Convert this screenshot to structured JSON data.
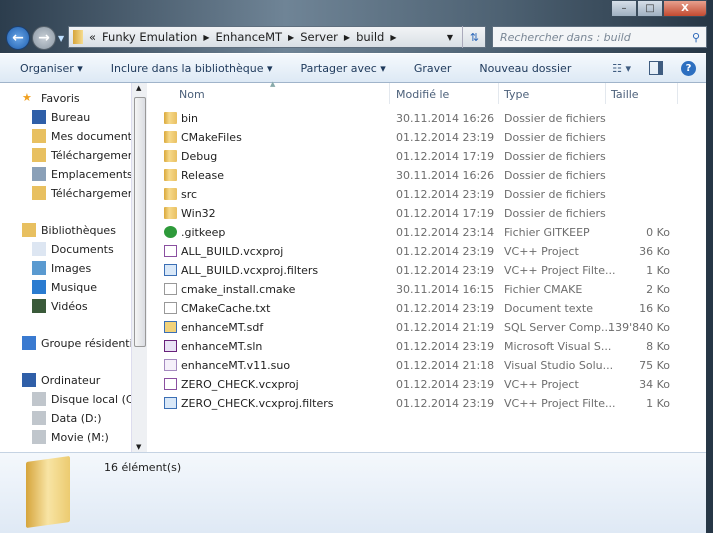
{
  "window": {
    "controls": {
      "minimize": "–",
      "maximize": "□",
      "close": "X"
    }
  },
  "address": {
    "prefix": "«",
    "crumbs": [
      "Funky Emulation",
      "EnhanceMT",
      "Server",
      "build"
    ],
    "search_placeholder": "Rechercher dans : build"
  },
  "toolbar": {
    "organize": "Organiser ▾",
    "include": "Inclure dans la bibliothèque ▾",
    "share": "Partager avec ▾",
    "burn": "Graver",
    "new_folder": "Nouveau dossier",
    "help": "?"
  },
  "sidebar": {
    "items": [
      {
        "label": "Favoris",
        "icon": "star-icon",
        "level": 0
      },
      {
        "label": "Bureau",
        "icon": "desktop-icon",
        "level": 1
      },
      {
        "label": "Mes documents",
        "icon": "documents-folder-icon",
        "level": 1
      },
      {
        "label": "Téléchargements",
        "icon": "downloads-icon",
        "level": 1
      },
      {
        "label": "Emplacements récents",
        "icon": "recent-places-icon",
        "level": 1
      },
      {
        "label": "Téléchargements",
        "icon": "downloads-icon",
        "level": 1
      },
      {
        "label": "Bibliothèques",
        "icon": "libraries-icon",
        "level": 0
      },
      {
        "label": "Documents",
        "icon": "document-icon",
        "level": 1
      },
      {
        "label": "Images",
        "icon": "pictures-icon",
        "level": 1
      },
      {
        "label": "Musique",
        "icon": "music-icon",
        "level": 1
      },
      {
        "label": "Vidéos",
        "icon": "video-icon",
        "level": 1
      },
      {
        "label": "Groupe résidentiel",
        "icon": "homegroup-icon",
        "level": 0
      },
      {
        "label": "Ordinateur",
        "icon": "computer-icon",
        "level": 0
      },
      {
        "label": "Disque local (C:)",
        "icon": "drive-icon",
        "level": 1
      },
      {
        "label": "Data (D:)",
        "icon": "drive-icon",
        "level": 1
      },
      {
        "label": "Movie (M:)",
        "icon": "drive-icon",
        "level": 1
      }
    ]
  },
  "columns": {
    "name": "Nom",
    "modified": "Modifié le",
    "type": "Type",
    "size": "Taille"
  },
  "files": [
    {
      "name": "bin",
      "modified": "30.11.2014 16:26",
      "type": "Dossier de fichiers",
      "size": "",
      "icon": "folder"
    },
    {
      "name": "CMakeFiles",
      "modified": "01.12.2014 23:19",
      "type": "Dossier de fichiers",
      "size": "",
      "icon": "folder"
    },
    {
      "name": "Debug",
      "modified": "01.12.2014 17:19",
      "type": "Dossier de fichiers",
      "size": "",
      "icon": "folder"
    },
    {
      "name": "Release",
      "modified": "30.11.2014 16:26",
      "type": "Dossier de fichiers",
      "size": "",
      "icon": "folder"
    },
    {
      "name": "src",
      "modified": "01.12.2014 23:19",
      "type": "Dossier de fichiers",
      "size": "",
      "icon": "folder"
    },
    {
      "name": "Win32",
      "modified": "01.12.2014 17:19",
      "type": "Dossier de fichiers",
      "size": "",
      "icon": "folder"
    },
    {
      "name": ".gitkeep",
      "modified": "01.12.2014 23:14",
      "type": "Fichier GITKEEP",
      "size": "0 Ko",
      "icon": "git"
    },
    {
      "name": "ALL_BUILD.vcxproj",
      "modified": "01.12.2014 23:19",
      "type": "VC++ Project",
      "size": "36 Ko",
      "icon": "proj"
    },
    {
      "name": "ALL_BUILD.vcxproj.filters",
      "modified": "01.12.2014 23:19",
      "type": "VC++ Project Filte...",
      "size": "1 Ko",
      "icon": "filt"
    },
    {
      "name": "cmake_install.cmake",
      "modified": "30.11.2014 16:15",
      "type": "Fichier CMAKE",
      "size": "2 Ko",
      "icon": "doc"
    },
    {
      "name": "CMakeCache.txt",
      "modified": "01.12.2014 23:19",
      "type": "Document texte",
      "size": "16 Ko",
      "icon": "doc"
    },
    {
      "name": "enhanceMT.sdf",
      "modified": "01.12.2014 21:19",
      "type": "SQL Server Comp...",
      "size": "139'840 Ko",
      "icon": "sdf"
    },
    {
      "name": "enhanceMT.sln",
      "modified": "01.12.2014 23:19",
      "type": "Microsoft Visual S...",
      "size": "8 Ko",
      "icon": "sln"
    },
    {
      "name": "enhanceMT.v11.suo",
      "modified": "01.12.2014 21:18",
      "type": "Visual Studio Solu...",
      "size": "75 Ko",
      "icon": "suo"
    },
    {
      "name": "ZERO_CHECK.vcxproj",
      "modified": "01.12.2014 23:19",
      "type": "VC++ Project",
      "size": "34 Ko",
      "icon": "proj"
    },
    {
      "name": "ZERO_CHECK.vcxproj.filters",
      "modified": "01.12.2014 23:19",
      "type": "VC++ Project Filte...",
      "size": "1 Ko",
      "icon": "filt"
    }
  ],
  "details": {
    "count": "16 élément(s)"
  }
}
